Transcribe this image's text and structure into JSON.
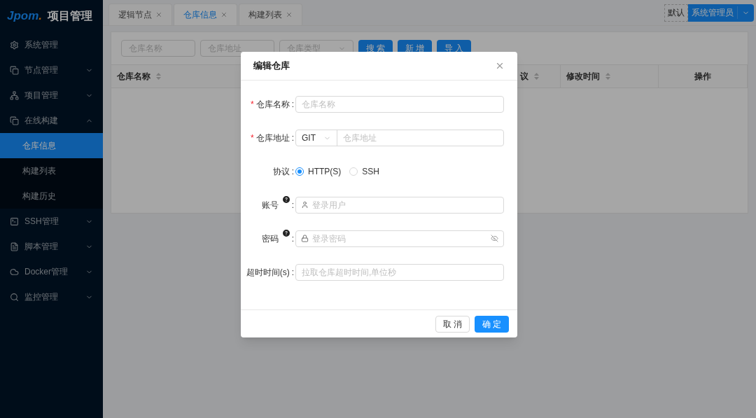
{
  "sidebar": {
    "logo": {
      "text": "Jpom",
      "dot": "."
    },
    "title": "项目管理",
    "items": [
      {
        "label": "系统管理"
      },
      {
        "label": "节点管理",
        "expanded": false
      },
      {
        "label": "项目管理",
        "expanded": false
      },
      {
        "label": "在线构建",
        "expanded": true,
        "children": [
          {
            "label": "仓库信息",
            "selected": true
          },
          {
            "label": "构建列表",
            "selected": false
          },
          {
            "label": "构建历史",
            "selected": false
          }
        ]
      },
      {
        "label": "SSH管理",
        "expanded": false
      },
      {
        "label": "脚本管理",
        "expanded": false
      },
      {
        "label": "Docker管理",
        "expanded": false
      },
      {
        "label": "监控管理",
        "expanded": false
      }
    ]
  },
  "tabs": [
    {
      "label": "逻辑节点",
      "selected": false
    },
    {
      "label": "仓库信息",
      "selected": true
    },
    {
      "label": "构建列表",
      "selected": false
    }
  ],
  "user": {
    "workspace": "默认",
    "name": "系统管理员"
  },
  "filters": {
    "fields": [
      {
        "placeholder": "仓库名称"
      },
      {
        "placeholder": "仓库地址"
      },
      {
        "placeholder": "仓库类型"
      }
    ],
    "buttons": [
      "搜 索",
      "新 增",
      "导 入"
    ]
  },
  "table": {
    "columns": [
      {
        "label": "仓库名称",
        "sortable": true
      },
      {
        "label": "议",
        "sortable": true
      },
      {
        "label": "修改时间",
        "sortable": true
      },
      {
        "label": "操作",
        "sortable": false
      }
    ]
  },
  "dialog": {
    "title": "编辑仓库",
    "fields": [
      {
        "kind": "text",
        "required_mark": "*",
        "label": "仓库名称",
        "colon": ":",
        "placeholder": "仓库名称"
      },
      {
        "kind": "address",
        "required_mark": "*",
        "label": "仓库地址",
        "colon": ":",
        "select": "GIT",
        "placeholder": "仓库地址"
      },
      {
        "kind": "radio",
        "label": "协议",
        "colon": ":",
        "options": [
          {
            "label": "HTTP(S)",
            "selected": true
          },
          {
            "label": "SSH",
            "selected": false
          }
        ]
      },
      {
        "kind": "user",
        "label": "账号",
        "help": true,
        "colon": ":",
        "placeholder": "登录用户"
      },
      {
        "kind": "password",
        "label": "密码",
        "help": true,
        "colon": ":",
        "placeholder": "登录密码"
      },
      {
        "kind": "text",
        "label": "超时时间(s)",
        "help": false,
        "colon": ":",
        "placeholder": "拉取仓库超时时间,单位秒"
      }
    ],
    "buttons": [
      {
        "label": "取 消",
        "primary": false
      },
      {
        "label": "确 定",
        "primary": true
      }
    ]
  }
}
